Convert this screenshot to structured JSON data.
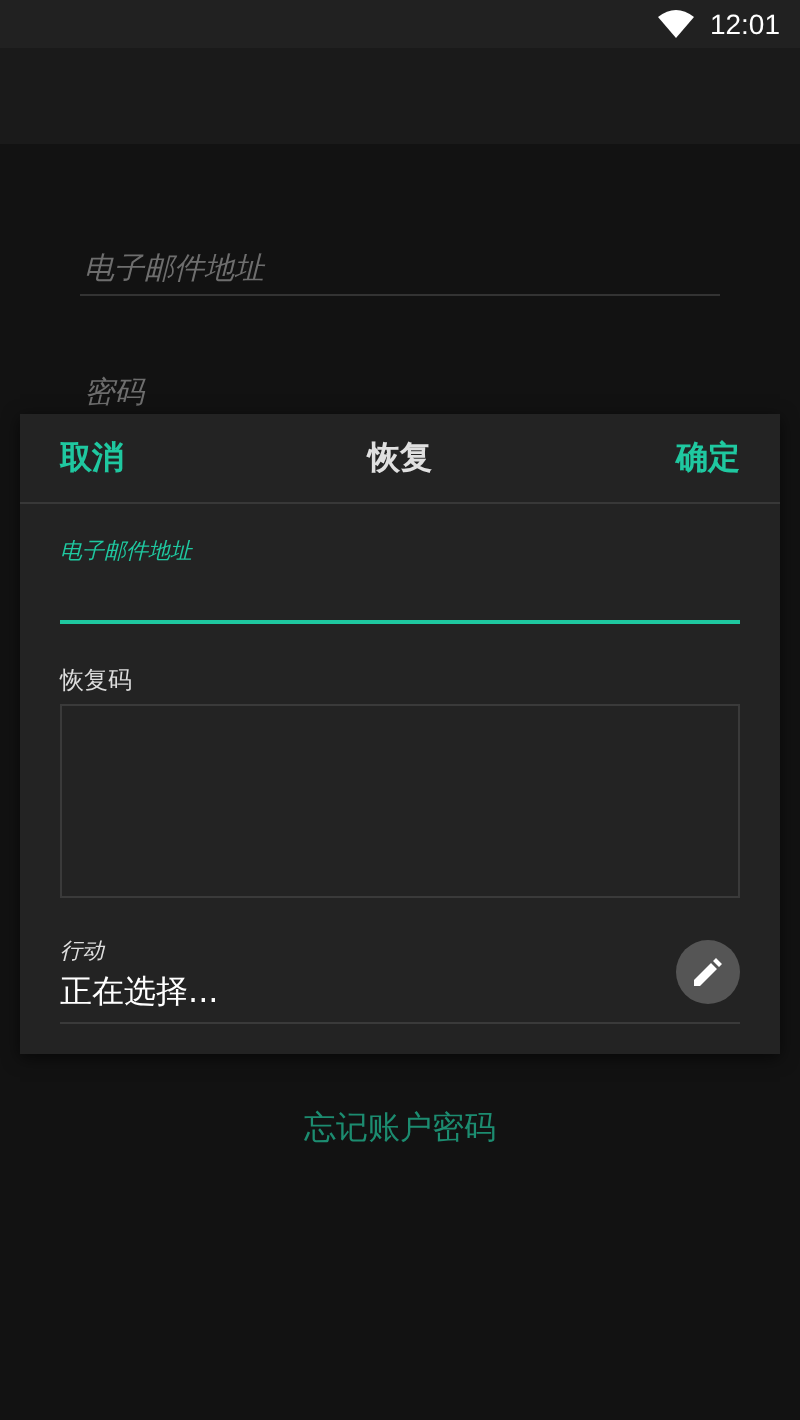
{
  "status_bar": {
    "time": "12:01"
  },
  "login_form": {
    "email_field": {
      "placeholder": "电子邮件地址"
    },
    "password_field": {
      "placeholder": "密码"
    },
    "forgot_password_link": "忘记账户密码"
  },
  "dialog": {
    "cancel": "取消",
    "title": "恢复",
    "confirm": "确定",
    "email_field": {
      "label": "电子邮件地址",
      "focused": true
    },
    "recovery_code": {
      "label": "恢复码"
    },
    "action": {
      "label": "行动",
      "value": "正在选择..."
    }
  }
}
